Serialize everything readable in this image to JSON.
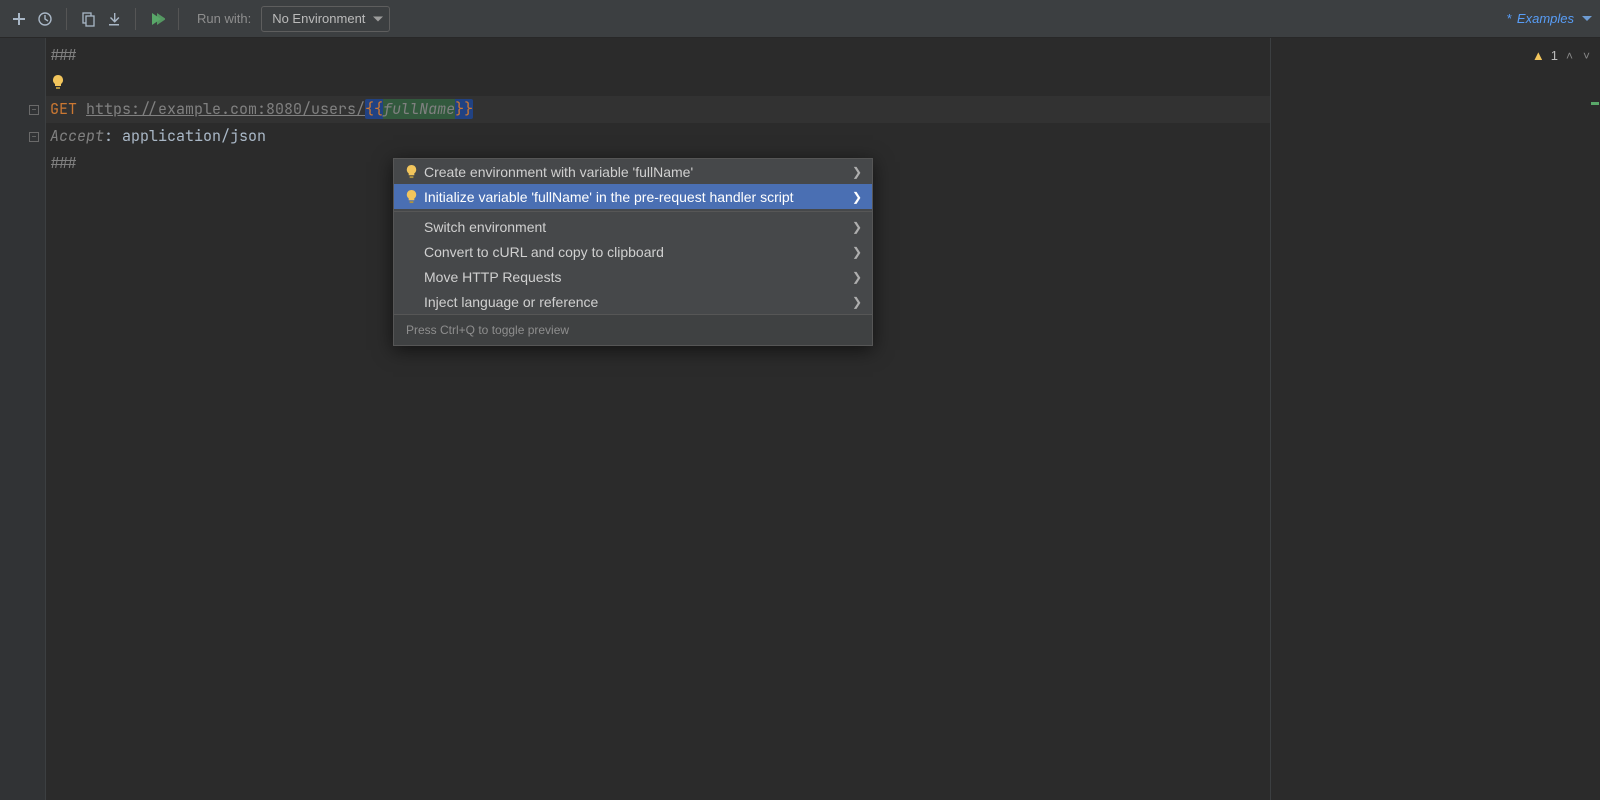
{
  "toolbar": {
    "run_with_label": "Run with:",
    "env_select_value": "No Environment",
    "examples_label": "Examples"
  },
  "code": {
    "line1": "###",
    "method": "GET",
    "url_prefix": "https://example.com:8080/users/",
    "var_open": "{{",
    "var_name": "fullName",
    "var_close": "}}",
    "header_name": "Accept",
    "header_sep": ": ",
    "header_value": "application/json",
    "line5": "###"
  },
  "inspection": {
    "count": "1"
  },
  "popup": {
    "items": [
      {
        "label": "Create environment with variable 'fullName'",
        "bulb": true
      },
      {
        "label": "Initialize variable 'fullName' in the pre-request handler script",
        "bulb": true,
        "selected": true
      },
      {
        "label": "Switch environment",
        "bulb": false
      },
      {
        "label": "Convert to cURL and copy to clipboard",
        "bulb": false
      },
      {
        "label": "Move HTTP Requests",
        "bulb": false
      },
      {
        "label": "Inject language or reference",
        "bulb": false
      }
    ],
    "footer": "Press Ctrl+Q to toggle preview"
  }
}
